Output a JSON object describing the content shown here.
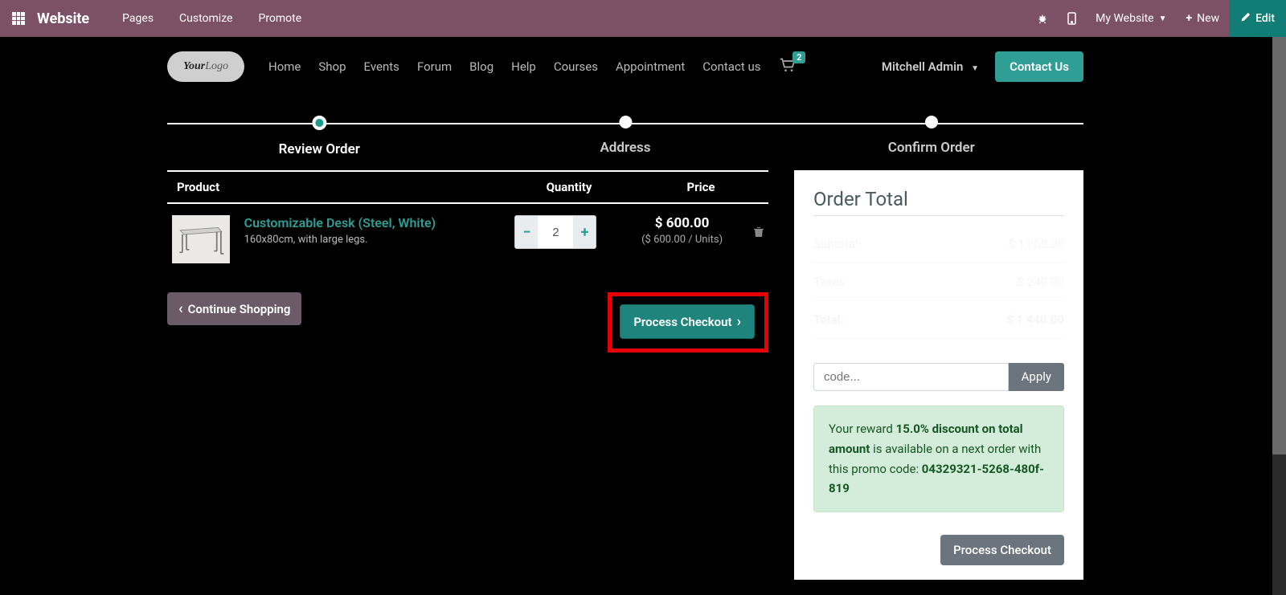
{
  "topbar": {
    "brand": "Website",
    "menu": [
      "Pages",
      "Customize",
      "Promote"
    ],
    "mywebsite": "My Website",
    "new": "New",
    "edit": "Edit"
  },
  "nav": {
    "items": [
      "Home",
      "Shop",
      "Events",
      "Forum",
      "Blog",
      "Help",
      "Courses",
      "Appointment",
      "Contact us"
    ],
    "cart_count": "2",
    "user": "Mitchell Admin",
    "contact": "Contact Us"
  },
  "logo": {
    "p1": "Your",
    "p2": "Logo"
  },
  "steps": [
    {
      "label": "Review Order",
      "active": true
    },
    {
      "label": "Address",
      "active": false
    },
    {
      "label": "Confirm Order",
      "active": false
    }
  ],
  "cart": {
    "headers": {
      "product": "Product",
      "qty": "Quantity",
      "price": "Price"
    },
    "item": {
      "name": "Customizable Desk (Steel, White)",
      "desc": "160x80cm, with large legs.",
      "qty": "2",
      "price": "$ 600.00",
      "unit": "($ 600.00 / Units)"
    },
    "continue": "Continue Shopping",
    "process": "Process Checkout"
  },
  "summary": {
    "title": "Order Total",
    "subtotal_label": "Subtotal:",
    "subtotal": "$ 1,200.00",
    "taxes_label": "Taxes:",
    "taxes": "$ 240.00",
    "total_label": "Total:",
    "total": "$ 1,440.00",
    "promo_placeholder": "code...",
    "apply": "Apply",
    "reward_p1": "Your reward ",
    "reward_bold1": "15.0% discount on total amount",
    "reward_p2": " is available on a next order with this promo code: ",
    "reward_bold2": "04329321-5268-480f-819",
    "process": "Process Checkout"
  }
}
